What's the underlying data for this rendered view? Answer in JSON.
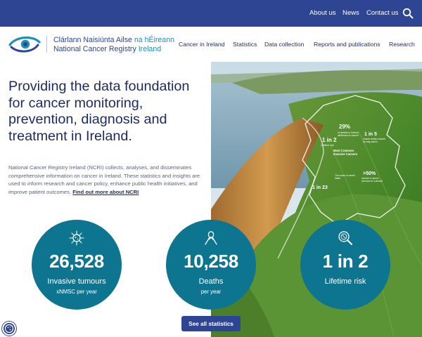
{
  "top_links": [
    {
      "label": "About us"
    },
    {
      "label": "News"
    },
    {
      "label": "Contact us"
    }
  ],
  "logo": {
    "line1_main": "Clárlann Naisiúnta Ailse",
    "line1_accent": "na hÉireann",
    "line2_main": "National Cancer Registry",
    "line2_accent": "Ireland"
  },
  "nav": [
    {
      "label": "Cancer in Ireland"
    },
    {
      "label": "Statistics"
    },
    {
      "label": "Data collection"
    },
    {
      "label": "Reports and publications"
    },
    {
      "label": "Research"
    }
  ],
  "hero": {
    "headline": "Providing the data foundation for cancer monitoring, prevention, diagnosis and treatment in Ireland.",
    "intro": "National Cancer Registry Ireland (NCRI) collects, analyses, and disseminates comprehensive information on cancer in Ireland. These statistics and insights are used to inform research and cancer policy, enhance public health initiatives, and improve patient outcomes.",
    "intro_link": "Find out more about NCRI"
  },
  "infographic": {
    "pct_29": "29%",
    "pct_29_text": "of deaths in Ireland attributed to cancer",
    "one_in_2": "1 in 2",
    "one_in_2_text": "Lifetime risk",
    "one_in_5": "1 in 5",
    "one_in_5_text": "Cancer deaths caused by lung cancer",
    "most_common": "Most Common Invasive Cancers",
    "over_50": ">50%",
    "over_50_text": "cancers & cancer survivors in a decade",
    "one_in_23": "1 in 23",
    "survivor_text": "The cause of cancer death"
  },
  "stats": [
    {
      "value": "26,528",
      "label": "Invasive tumours",
      "sub": "xNMSC per year",
      "icon": "virus-icon"
    },
    {
      "value": "10,258",
      "label": "Deaths",
      "sub": "per year",
      "icon": "ribbon-icon"
    },
    {
      "value": "1 in 2",
      "label": "Lifetime risk",
      "sub": "",
      "icon": "magnifier-icon"
    }
  ],
  "see_all_label": "See all statistics",
  "colors": {
    "brand_navy": "#2d4593",
    "stat_teal": "#0e7591",
    "logo_accent": "#1f8fb5"
  }
}
